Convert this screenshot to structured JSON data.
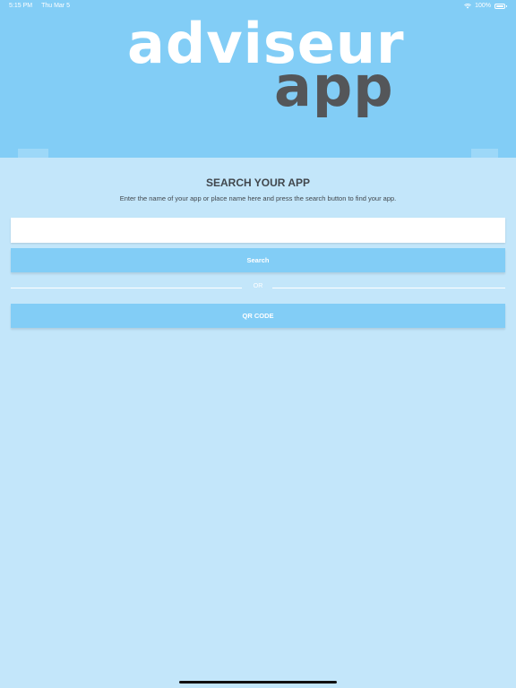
{
  "status_bar": {
    "time": "5:15 PM",
    "date": "Thu Mar 5",
    "battery": "100%",
    "wifi_icon": "wifi-icon",
    "battery_icon": "battery-icon"
  },
  "logo": {
    "line1": "adviseur",
    "line2": "app"
  },
  "search": {
    "title": "SEARCH YOUR APP",
    "description": "Enter the name of your app or place name here and press the search button to find your app.",
    "input_value": "",
    "input_placeholder": "",
    "button_label": "Search"
  },
  "divider": {
    "label": "OR"
  },
  "qr": {
    "button_label": "QR CODE"
  },
  "colors": {
    "header": "#82cdf6",
    "background": "#c3e6fa",
    "button": "#82cdf6",
    "logo_dark": "#545659",
    "text": "#41474d"
  }
}
